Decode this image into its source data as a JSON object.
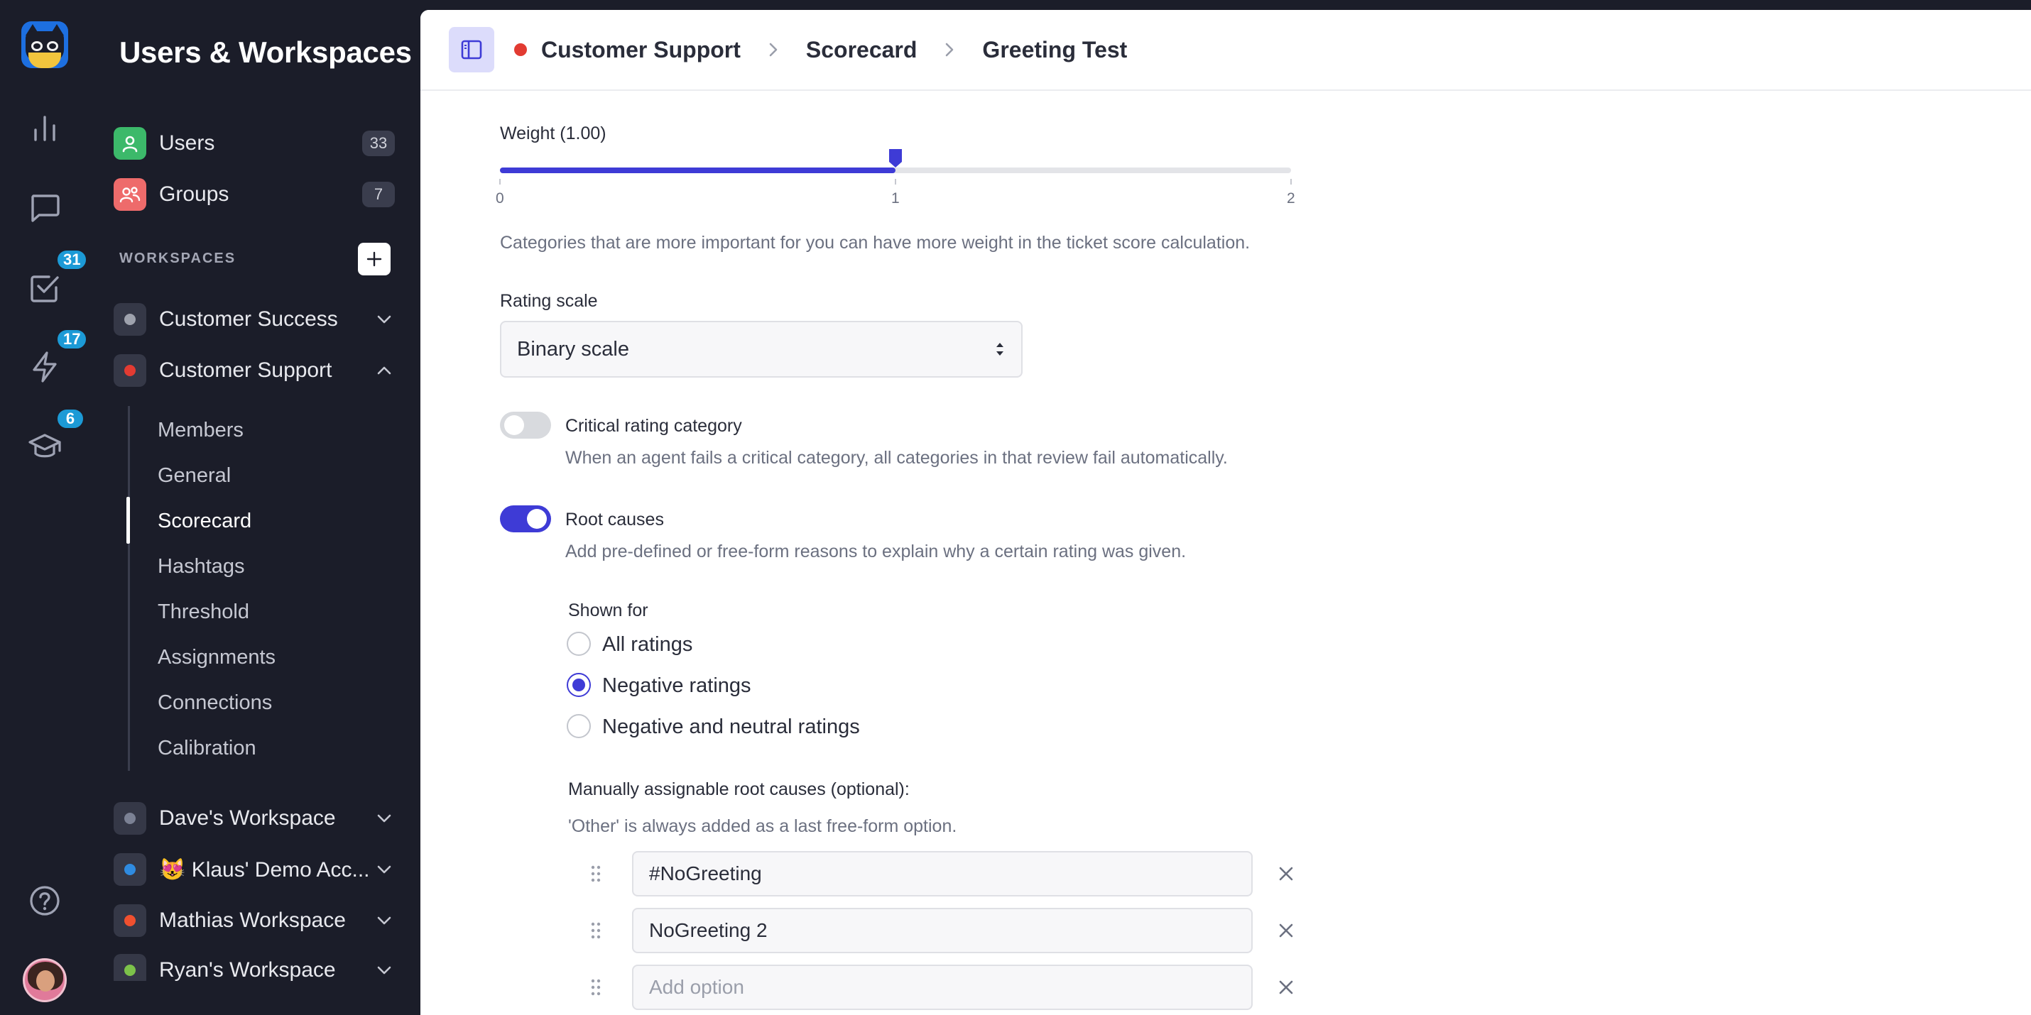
{
  "rail": {
    "badges": {
      "tasks": "31",
      "activity": "17",
      "learning": "6"
    }
  },
  "sidebar": {
    "title": "Users & Workspaces",
    "users": {
      "label": "Users",
      "count": "33"
    },
    "groups": {
      "label": "Groups",
      "count": "7"
    },
    "workspaces_heading": "WORKSPACES",
    "workspaces": [
      {
        "label": "Customer Success",
        "color": "#9ea2ad"
      },
      {
        "label": "Customer Support",
        "color": "#e23b32"
      },
      {
        "label": "Dave's Workspace",
        "color": "#7b8194"
      },
      {
        "label": "😻 Klaus' Demo Acc...",
        "color": "#2f8be0"
      },
      {
        "label": "Mathias Workspace",
        "color": "#f0502f"
      },
      {
        "label": "Ryan's Workspace",
        "color": "#7cc24a"
      }
    ],
    "sub_items": [
      "Members",
      "General",
      "Scorecard",
      "Hashtags",
      "Threshold",
      "Assignments",
      "Connections",
      "Calibration"
    ],
    "active_sub_item": "Scorecard"
  },
  "breadcrumb": [
    "Customer Support",
    "Scorecard",
    "Greeting Test"
  ],
  "weight": {
    "label": "Weight (1.00)",
    "value": 1.0,
    "min": 0,
    "max": 2,
    "ticks": [
      "0",
      "1",
      "2"
    ],
    "help": "Categories that are more important for you can have more weight in the ticket score calculation."
  },
  "rating_scale": {
    "label": "Rating scale",
    "value": "Binary scale"
  },
  "critical": {
    "label": "Critical rating category",
    "help": "When an agent fails a critical category, all categories in that review fail automatically.",
    "on": false
  },
  "root_causes": {
    "label": "Root causes",
    "help": "Add pre-defined or free-form reasons to explain why a certain rating was given.",
    "on": true,
    "shown_for_label": "Shown for",
    "options": [
      "All ratings",
      "Negative ratings",
      "Negative and neutral ratings"
    ],
    "selected": "Negative ratings",
    "manual_label": "Manually assignable root causes (optional):",
    "manual_help": "'Other' is always added as a last free-form option.",
    "items": [
      "#NoGreeting",
      "NoGreeting 2"
    ],
    "add_placeholder": "Add option"
  },
  "colors": {
    "accent": "#3e3bd6",
    "badge": "#1c9ad6",
    "users_icon": "#3cb96a",
    "groups_icon": "#ee6b6b"
  }
}
